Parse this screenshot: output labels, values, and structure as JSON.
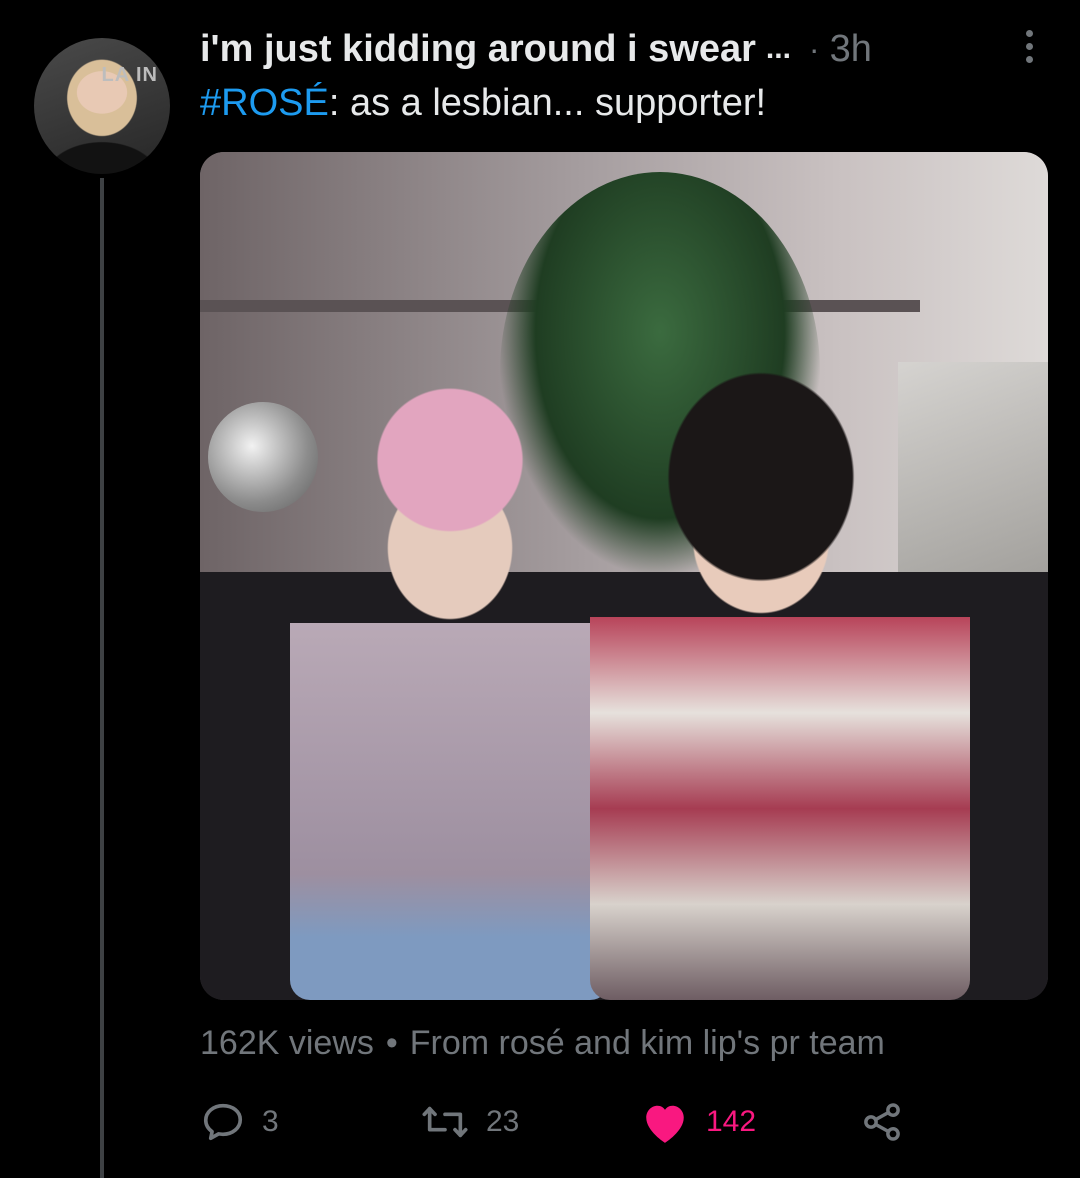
{
  "tweet": {
    "display_name": "i'm just kidding around i swear",
    "name_ellipsis": "...",
    "separator": "·",
    "time": "3h",
    "avatar_brand_text": "LA   IN",
    "hashtag": "#ROSÉ",
    "text_rest": ": as a lesbian... supporter!",
    "media": {
      "views": "162K views",
      "source_separator": "•",
      "source": "From rosé and kim lip's pr team"
    },
    "actions": {
      "replies": "3",
      "retweets": "23",
      "likes": "142"
    }
  },
  "icons": {
    "reply": "reply-icon",
    "retweet": "retweet-icon",
    "like": "heart-icon",
    "share": "share-icon",
    "more": "more-vertical-icon"
  },
  "colors": {
    "background": "#000000",
    "text": "#e7e9ea",
    "muted": "#71767b",
    "hashtag": "#1d9bf0",
    "like": "#f91880"
  }
}
